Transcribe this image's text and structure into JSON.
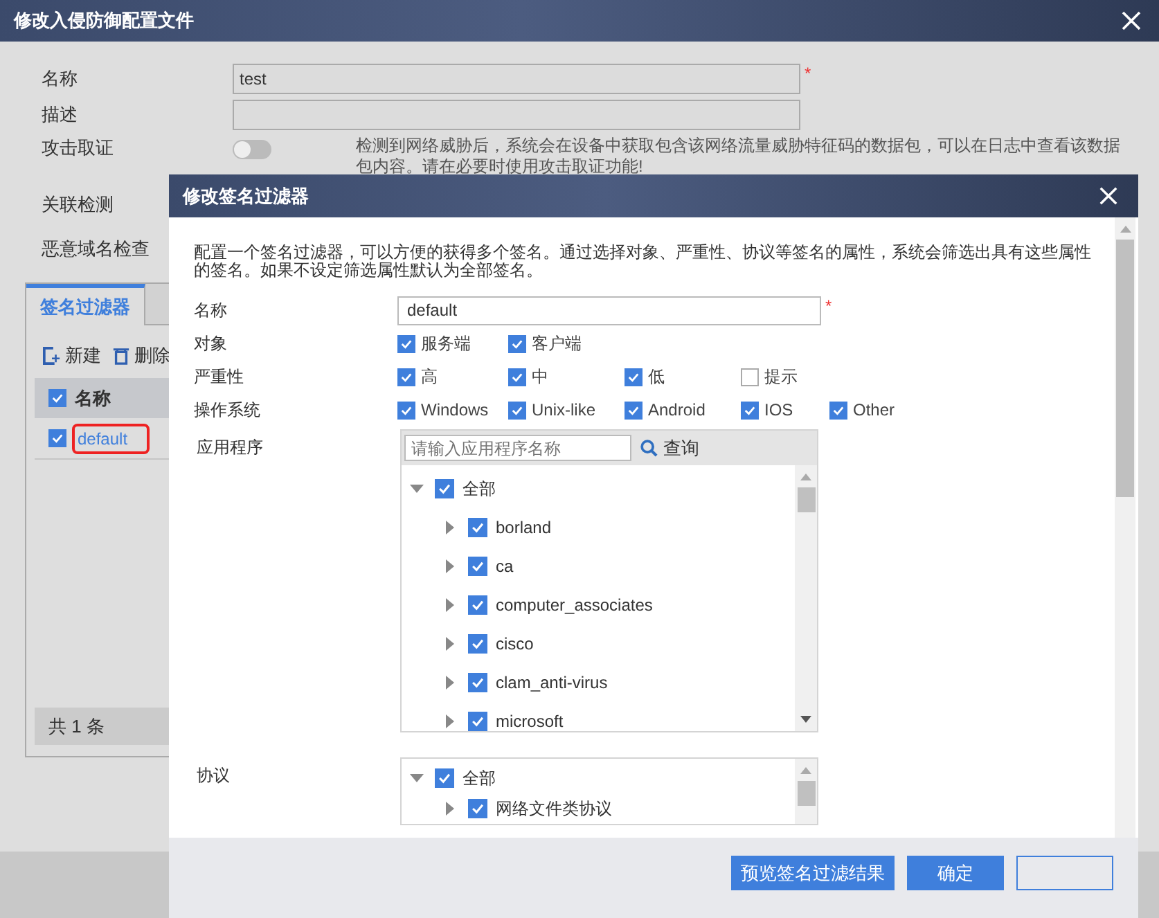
{
  "outer": {
    "title": "修改入侵防御配置文件",
    "name": {
      "label": "名称",
      "value": "test",
      "required_mark": "*"
    },
    "description": {
      "label": "描述"
    },
    "forensics": {
      "label": "攻击取证",
      "on": false,
      "hint": "检测到网络威胁后，系统会在设备中获取包含该网络流量威胁特征码的数据包，可以在日志中查看该数据包内容。请在必要时使用攻击取证功能!"
    },
    "correlation": {
      "label": "关联检测"
    },
    "malicious_domain": {
      "label": "恶意域名检查"
    },
    "tabs": [
      {
        "label": "签名过滤器",
        "selected": true
      },
      {
        "selected": false
      }
    ],
    "toolbar": [
      {
        "label": "新建",
        "kind": "new"
      },
      {
        "label": "删除",
        "kind": "delete"
      }
    ],
    "table": {
      "header": {
        "label": "名称",
        "checked": true
      },
      "rows": [
        {
          "name": "default",
          "checked": true,
          "highlighted": true
        }
      ]
    },
    "footer": "共 1 条"
  },
  "inner": {
    "title": "修改签名过滤器",
    "intro": "配置一个签名过滤器，可以方便的获得多个签名。通过选择对象、严重性、协议等签名的属性，系统会筛选出具有这些属性的签名。如果不设定筛选属性默认为全部签名。",
    "name": {
      "label": "名称",
      "value": "default",
      "required_mark": "*"
    },
    "option_groups": [
      {
        "label": "对象",
        "options": [
          {
            "label": "服务端",
            "checked": true
          },
          {
            "label": "客户端",
            "checked": true
          }
        ]
      },
      {
        "label": "严重性",
        "options": [
          {
            "label": "高",
            "checked": true
          },
          {
            "label": "中",
            "checked": true
          },
          {
            "label": "低",
            "checked": true
          },
          {
            "label": "提示",
            "checked": false
          }
        ]
      },
      {
        "label": "操作系统",
        "options": [
          {
            "label": "Windows",
            "checked": true
          },
          {
            "label": "Unix-like",
            "checked": true
          },
          {
            "label": "Android",
            "checked": true
          },
          {
            "label": "IOS",
            "checked": true
          },
          {
            "label": "Other",
            "checked": true
          }
        ]
      }
    ],
    "application": {
      "label": "应用程序",
      "search_placeholder": "请输入应用程序名称",
      "search_button": "查询",
      "tree": [
        {
          "label": "全部",
          "checked": true,
          "expanded": true,
          "children": [
            {
              "label": "borland",
              "checked": true,
              "expanded": false
            },
            {
              "label": "ca",
              "checked": true,
              "expanded": false
            },
            {
              "label": "computer_associates",
              "checked": true,
              "expanded": false
            },
            {
              "label": "cisco",
              "checked": true,
              "expanded": false
            },
            {
              "label": "clam_anti-virus",
              "checked": true,
              "expanded": false
            },
            {
              "label": "microsoft",
              "checked": true,
              "expanded": false
            }
          ]
        }
      ]
    },
    "protocol": {
      "label": "协议",
      "tree": [
        {
          "label": "全部",
          "checked": true,
          "expanded": true,
          "children": [
            {
              "label": "网络文件类协议",
              "checked": true,
              "expanded": false
            }
          ]
        }
      ]
    },
    "buttons": [
      {
        "label": "预览签名过滤结果",
        "kind": "primary"
      },
      {
        "label": "确定",
        "kind": "primary"
      },
      {
        "kind": "secondary"
      }
    ]
  }
}
